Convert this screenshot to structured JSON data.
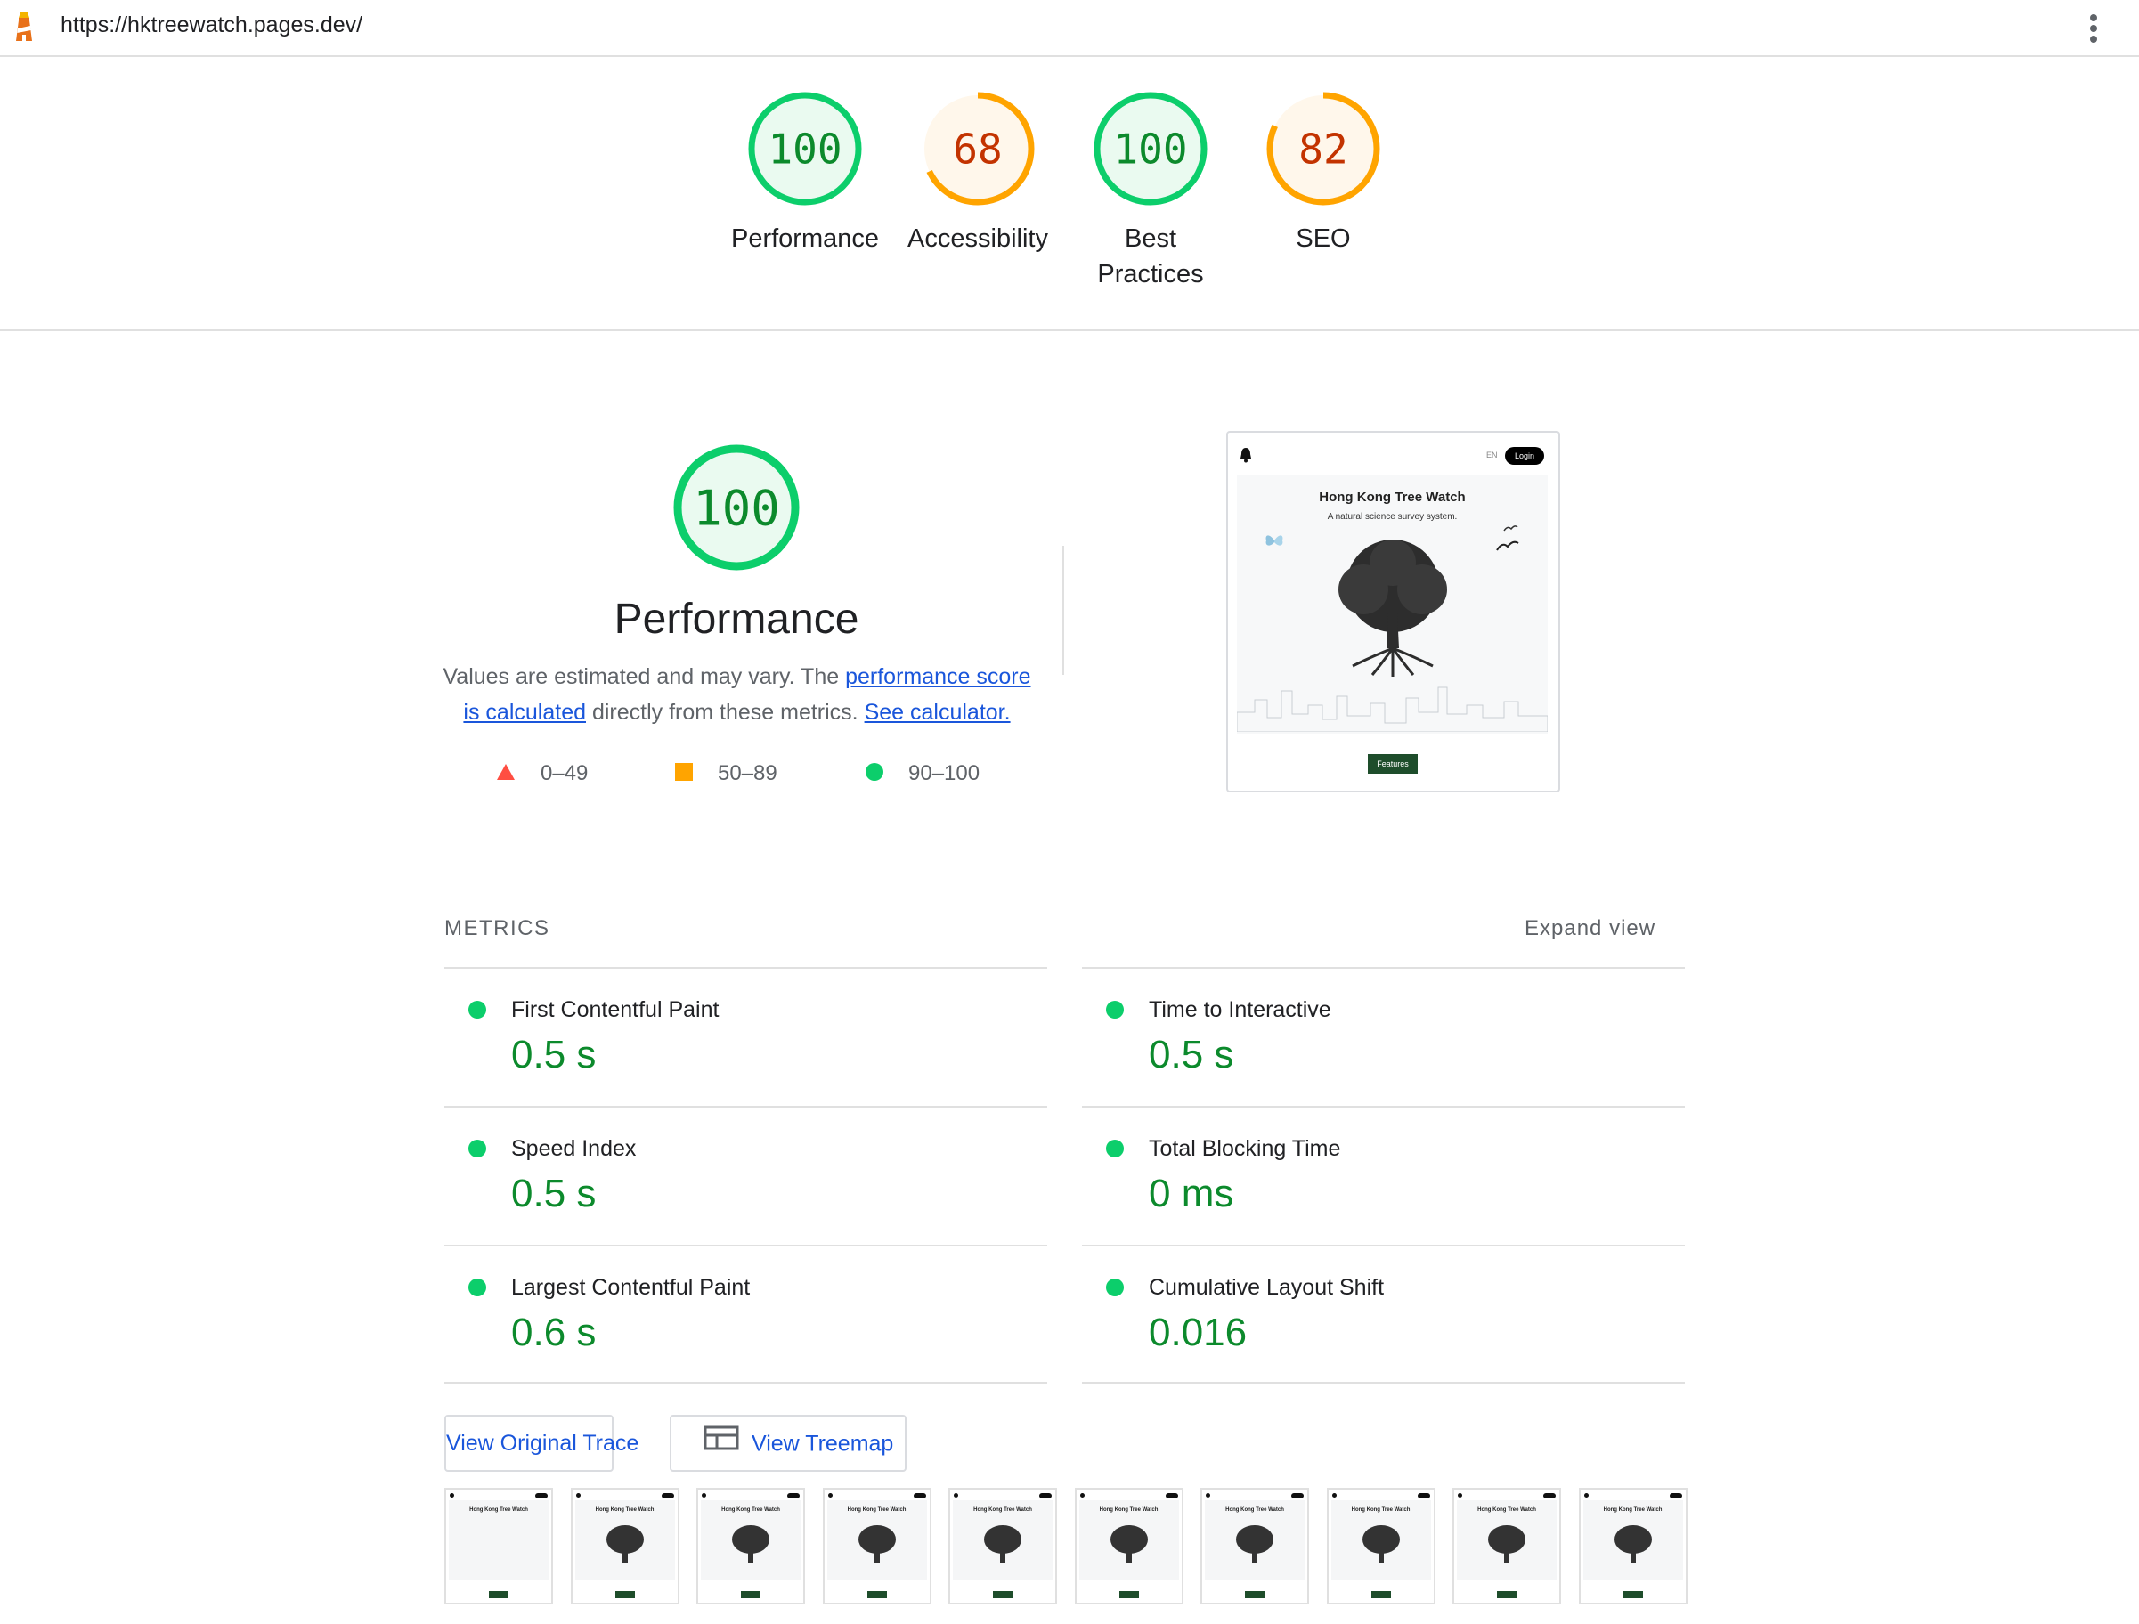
{
  "header": {
    "url": "https://hktreewatch.pages.dev/"
  },
  "colors": {
    "pass": "#0cce6b",
    "pass_text": "#0c8a2c",
    "average": "#ffa400",
    "average_text": "#c33300",
    "fail": "#ff4e42",
    "link": "#1a56db"
  },
  "gauges": [
    {
      "label": "Performance",
      "score": "100",
      "value": 100,
      "rating": "pass"
    },
    {
      "label": "Accessibility",
      "score": "68",
      "value": 68,
      "rating": "average"
    },
    {
      "label": "Best Practices",
      "score": "100",
      "value": 100,
      "rating": "pass"
    },
    {
      "label": "SEO",
      "score": "82",
      "value": 82,
      "rating": "average"
    }
  ],
  "performance": {
    "score": "100",
    "value": 100,
    "title": "Performance",
    "desc_prefix": "Values are estimated and may vary. The ",
    "desc_link": "performance score is calculated",
    "desc_middle": " directly from these metrics. ",
    "desc_calc_link": "See calculator.",
    "legend": [
      {
        "range": "0–49",
        "shape": "triangle"
      },
      {
        "range": "50–89",
        "shape": "square"
      },
      {
        "range": "90–100",
        "shape": "circle"
      }
    ]
  },
  "screenshot": {
    "site_title": "Hong Kong Tree Watch",
    "site_subtitle": "A natural science survey system.",
    "lang": "EN",
    "login": "Login",
    "features_button": "Features"
  },
  "metrics": {
    "heading": "METRICS",
    "expand_label": "Expand view",
    "items": [
      {
        "label": "First Contentful Paint",
        "value": "0.5 s"
      },
      {
        "label": "Time to Interactive",
        "value": "0.5 s"
      },
      {
        "label": "Speed Index",
        "value": "0.5 s"
      },
      {
        "label": "Total Blocking Time",
        "value": "0 ms"
      },
      {
        "label": "Largest Contentful Paint",
        "value": "0.6 s"
      },
      {
        "label": "Cumulative Layout Shift",
        "value": "0.016"
      }
    ]
  },
  "buttons": {
    "trace": "View Original Trace",
    "treemap": "View Treemap"
  },
  "filmstrip": {
    "frames": 10,
    "frame_title": "Hong Kong Tree Watch"
  }
}
